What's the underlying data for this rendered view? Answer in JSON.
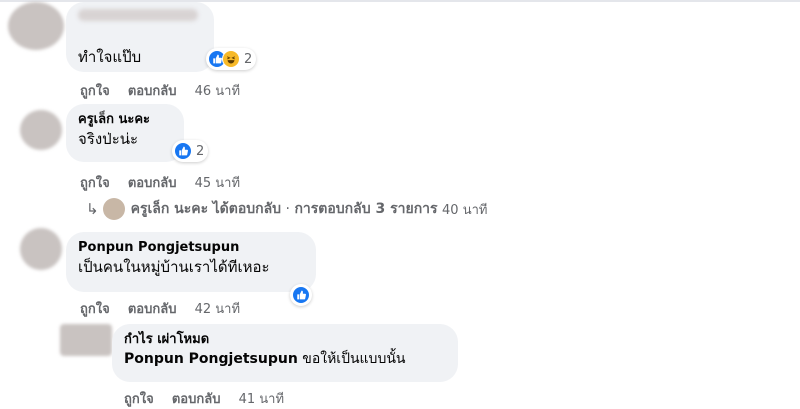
{
  "comments": [
    {
      "author": "",
      "text": "ทำใจแป๊บ",
      "reaction_count": "2",
      "reactions": [
        "like-icon",
        "haha-icon"
      ],
      "like_label": "ถูกใจ",
      "reply_label": "ตอบกลับ",
      "time": "46 นาที"
    },
    {
      "author": "ครูเล็ก นะคะ",
      "text": "จริงป่ะน่ะ",
      "reaction_count": "2",
      "reactions": [
        "like-icon"
      ],
      "like_label": "ถูกใจ",
      "reply_label": "ตอบกลับ",
      "time": "45 นาที",
      "replies_summary": {
        "name": "ครูเล็ก นะคะ",
        "replied": "ได้ตอบกลับ",
        "separator": "·",
        "count_text": "การตอบกลับ 3 รายการ",
        "time": "40 นาที"
      }
    },
    {
      "author": "Ponpun Pongjetsupun",
      "text": "เป็นคนในหมู่บ้านเราได้ทีเหอะ",
      "reactions": [
        "like-icon"
      ],
      "like_label": "ถูกใจ",
      "reply_label": "ตอบกลับ",
      "time": "42 นาที"
    },
    {
      "author": "กำไร เผ่าโหมด",
      "mention": "Ponpun Pongjetsupun",
      "text": "ขอให้เป็นแบบนั้น",
      "like_label": "ถูกใจ",
      "reply_label": "ตอบกลับ",
      "time": "41 นาที"
    }
  ],
  "colors": {
    "like": "#1877f2",
    "haha": "#f7b928",
    "bubble": "#f0f2f5",
    "meta": "#65676b"
  }
}
